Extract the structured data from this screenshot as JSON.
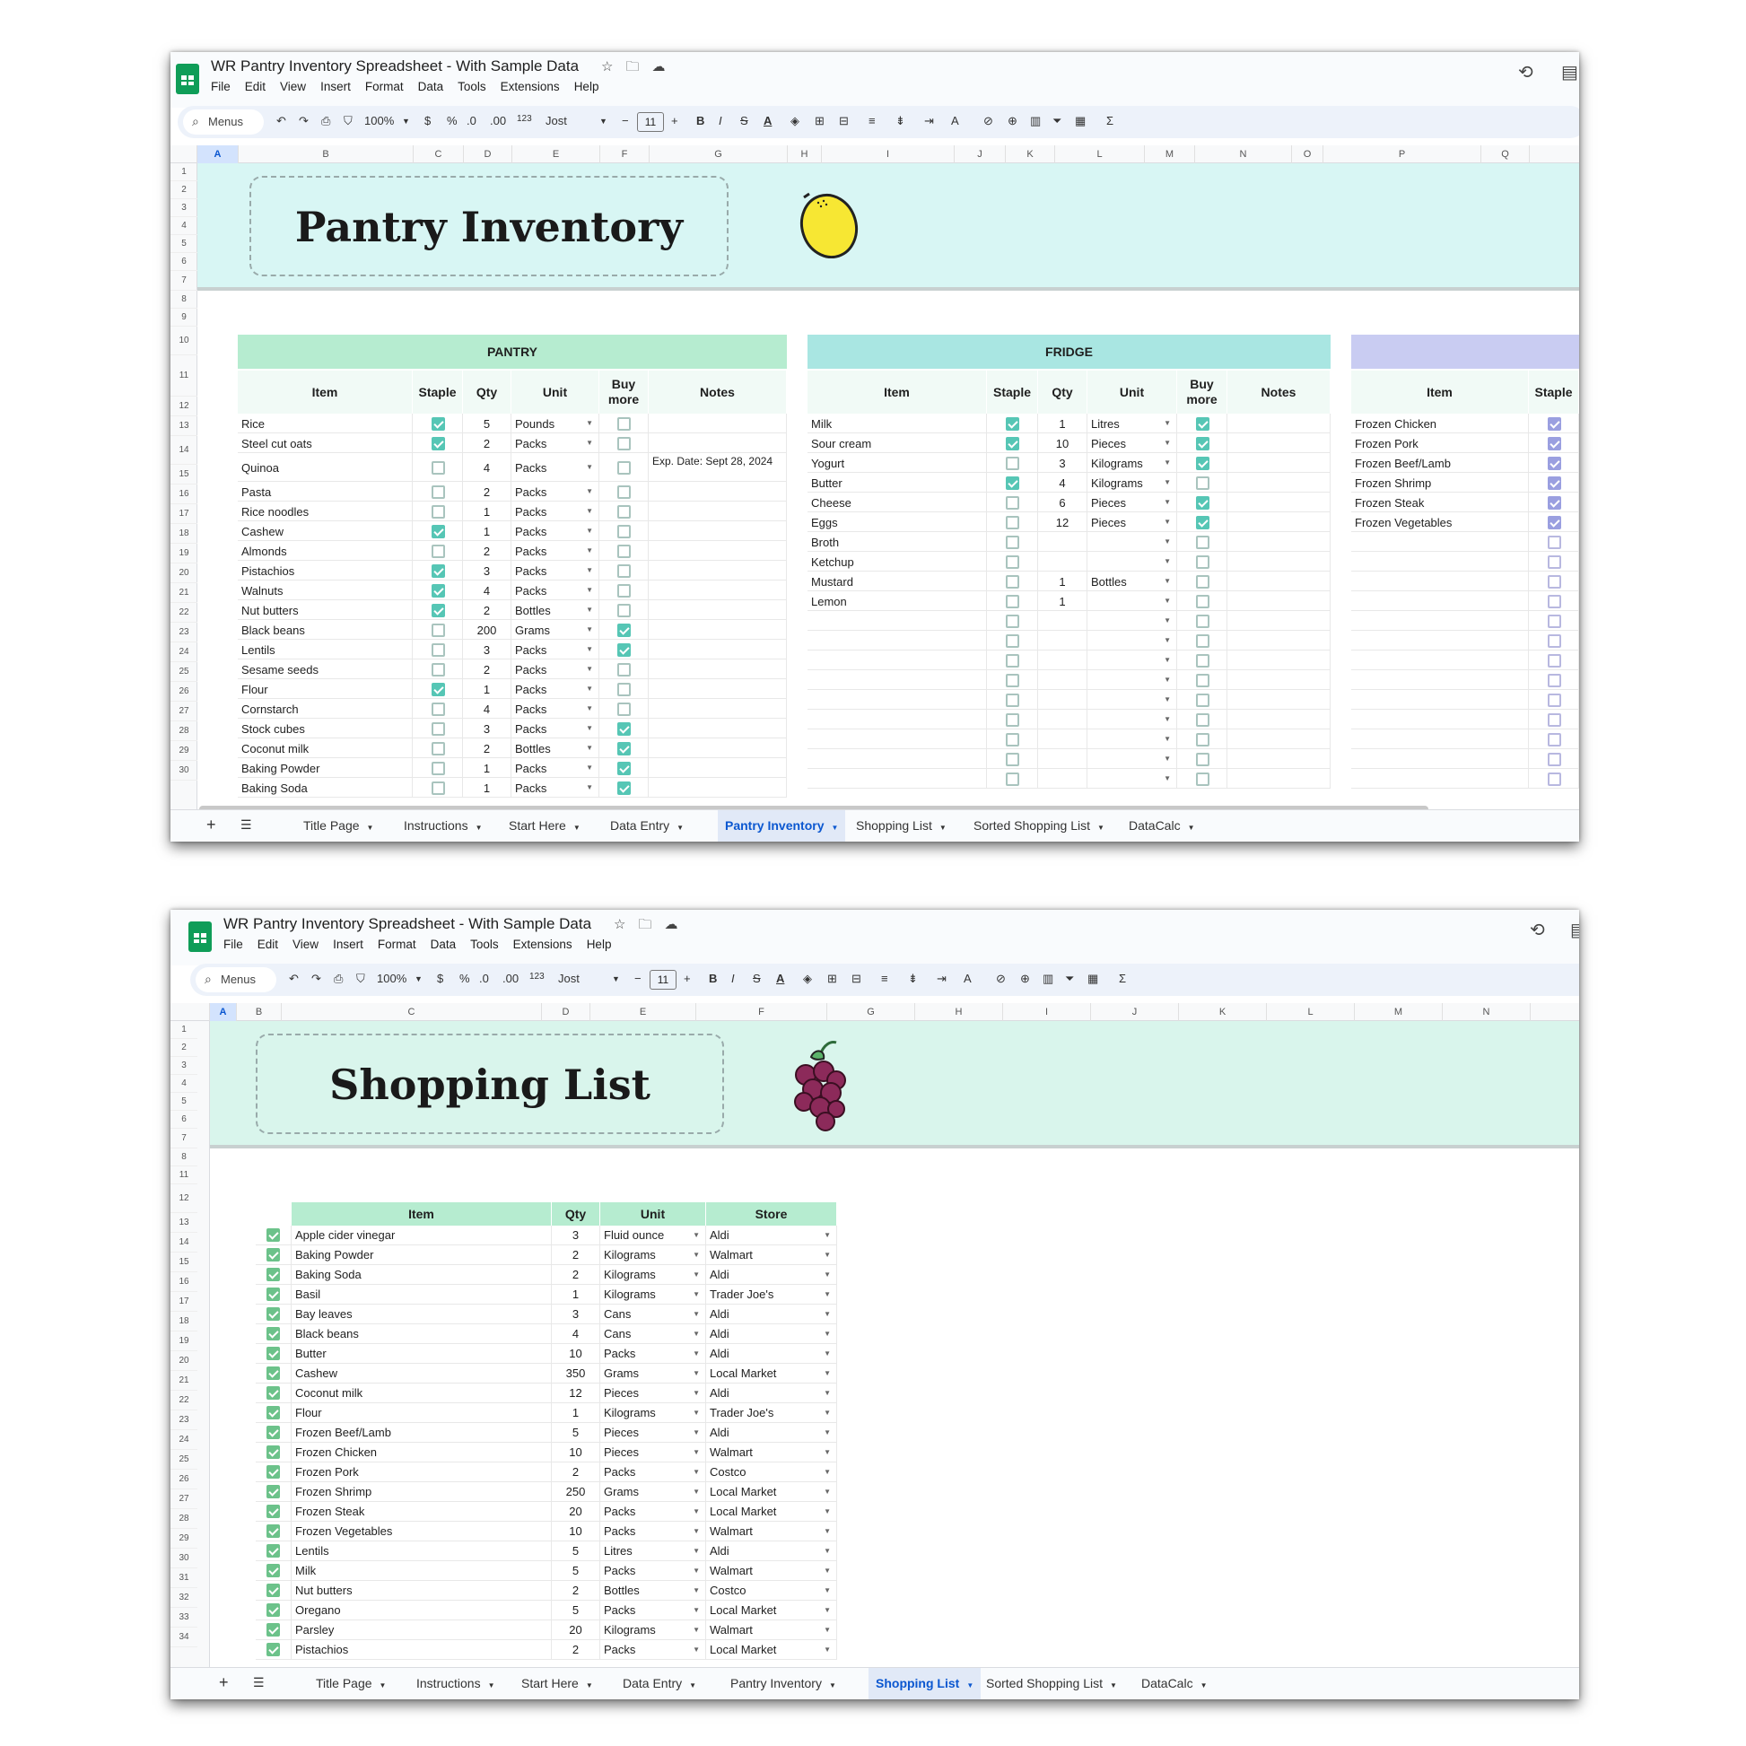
{
  "doc_title": "WR Pantry Inventory Spreadsheet - With Sample Data",
  "menus": [
    "File",
    "Edit",
    "View",
    "Insert",
    "Format",
    "Data",
    "Tools",
    "Extensions",
    "Help"
  ],
  "toolbar": {
    "search": "Menus",
    "zoom": "100%",
    "currency": "$",
    "percent": "%",
    "dec_minus": ".0",
    "dec_plus": ".00",
    "number_fmt": "123",
    "font": "Jost",
    "font_size": "11"
  },
  "tabs": [
    "Title Page",
    "Instructions",
    "Start Here",
    "Data Entry",
    "Pantry Inventory",
    "Shopping List",
    "Sorted Shopping List",
    "DataCalc"
  ],
  "sheet1": {
    "active_tab": "Pantry Inventory",
    "columns": [
      "A",
      "B",
      "C",
      "D",
      "E",
      "F",
      "G",
      "H",
      "I",
      "J",
      "K",
      "L",
      "M",
      "N",
      "O",
      "P",
      "Q"
    ],
    "rows": [
      "1",
      "2",
      "3",
      "4",
      "5",
      "6",
      "7",
      "8",
      "9",
      "10",
      "11",
      "12",
      "13",
      "14",
      "15",
      "16",
      "17",
      "18",
      "19",
      "20",
      "21",
      "22",
      "23",
      "24",
      "25",
      "26",
      "27",
      "28",
      "29",
      "30"
    ],
    "banner_title": "Pantry Inventory",
    "pantry": {
      "title": "PANTRY",
      "headers": [
        "Item",
        "Staple",
        "Qty",
        "Unit",
        "Buy\nmore",
        "Notes"
      ],
      "items": [
        [
          "Rice",
          true,
          "5",
          "Pounds",
          false,
          ""
        ],
        [
          "Steel cut oats",
          true,
          "2",
          "Packs",
          false,
          ""
        ],
        [
          "Quinoa",
          false,
          "4",
          "Packs",
          false,
          "Exp. Date: Sept 28, 2024"
        ],
        [
          "Pasta",
          false,
          "2",
          "Packs",
          false,
          ""
        ],
        [
          "Rice noodles",
          false,
          "1",
          "Packs",
          false,
          ""
        ],
        [
          "Cashew",
          true,
          "1",
          "Packs",
          false,
          ""
        ],
        [
          "Almonds",
          false,
          "2",
          "Packs",
          false,
          ""
        ],
        [
          "Pistachios",
          true,
          "3",
          "Packs",
          false,
          ""
        ],
        [
          "Walnuts",
          true,
          "4",
          "Packs",
          false,
          ""
        ],
        [
          "Nut butters",
          true,
          "2",
          "Bottles",
          false,
          ""
        ],
        [
          "Black beans",
          false,
          "200",
          "Grams",
          true,
          ""
        ],
        [
          "Lentils",
          false,
          "3",
          "Packs",
          true,
          ""
        ],
        [
          "Sesame seeds",
          false,
          "2",
          "Packs",
          false,
          ""
        ],
        [
          "Flour",
          true,
          "1",
          "Packs",
          false,
          ""
        ],
        [
          "Cornstarch",
          false,
          "4",
          "Packs",
          false,
          ""
        ],
        [
          "Stock cubes",
          false,
          "3",
          "Packs",
          true,
          ""
        ],
        [
          "Coconut milk",
          false,
          "2",
          "Bottles",
          true,
          ""
        ],
        [
          "Baking Powder",
          false,
          "1",
          "Packs",
          true,
          ""
        ],
        [
          "Baking Soda",
          false,
          "1",
          "Packs",
          true,
          ""
        ]
      ]
    },
    "fridge": {
      "title": "FRIDGE",
      "headers": [
        "Item",
        "Staple",
        "Qty",
        "Unit",
        "Buy\nmore",
        "Notes"
      ],
      "items": [
        [
          "Milk",
          true,
          "1",
          "Litres",
          true,
          ""
        ],
        [
          "Sour cream",
          true,
          "10",
          "Pieces",
          true,
          ""
        ],
        [
          "Yogurt",
          false,
          "3",
          "Kilograms",
          true,
          ""
        ],
        [
          "Butter",
          true,
          "4",
          "Kilograms",
          false,
          ""
        ],
        [
          "Cheese",
          false,
          "6",
          "Pieces",
          true,
          ""
        ],
        [
          "Eggs",
          false,
          "12",
          "Pieces",
          true,
          ""
        ],
        [
          "Broth",
          false,
          "",
          "",
          false,
          ""
        ],
        [
          "Ketchup",
          false,
          "",
          "",
          false,
          ""
        ],
        [
          "Mustard",
          false,
          "1",
          "Bottles",
          false,
          ""
        ],
        [
          "Lemon",
          false,
          "1",
          "",
          false,
          ""
        ],
        [
          "",
          false,
          "",
          "",
          false,
          ""
        ],
        [
          "",
          false,
          "",
          "",
          false,
          ""
        ],
        [
          "",
          false,
          "",
          "",
          false,
          ""
        ],
        [
          "",
          false,
          "",
          "",
          false,
          ""
        ],
        [
          "",
          false,
          "",
          "",
          false,
          ""
        ],
        [
          "",
          false,
          "",
          "",
          false,
          ""
        ],
        [
          "",
          false,
          "",
          "",
          false,
          ""
        ],
        [
          "",
          false,
          "",
          "",
          false,
          ""
        ],
        [
          "",
          false,
          "",
          "",
          false,
          ""
        ]
      ]
    },
    "freezer": {
      "headers": [
        "Item",
        "Staple"
      ],
      "items": [
        [
          "Frozen Chicken",
          true
        ],
        [
          "Frozen Pork",
          true
        ],
        [
          "Frozen Beef/Lamb",
          true
        ],
        [
          "Frozen Shrimp",
          true
        ],
        [
          "Frozen Steak",
          true
        ],
        [
          "Frozen Vegetables",
          true
        ],
        [
          "",
          false
        ],
        [
          "",
          false
        ],
        [
          "",
          false
        ],
        [
          "",
          false
        ],
        [
          "",
          false
        ],
        [
          "",
          false
        ],
        [
          "",
          false
        ],
        [
          "",
          false
        ],
        [
          "",
          false
        ],
        [
          "",
          false
        ],
        [
          "",
          false
        ],
        [
          "",
          false
        ],
        [
          "",
          false
        ]
      ]
    }
  },
  "sheet2": {
    "active_tab": "Shopping List",
    "columns": [
      "A",
      "B",
      "C",
      "D",
      "E",
      "F",
      "G",
      "H",
      "I",
      "J",
      "K",
      "L",
      "M",
      "N"
    ],
    "rows": [
      "1",
      "2",
      "3",
      "4",
      "5",
      "6",
      "7",
      "8",
      "11",
      "12",
      "13",
      "14",
      "15",
      "16",
      "17",
      "18",
      "19",
      "20",
      "21",
      "22",
      "23",
      "24",
      "25",
      "26",
      "27",
      "28",
      "29",
      "30",
      "31",
      "32",
      "33",
      "34"
    ],
    "banner_title": "Shopping List",
    "headers": [
      "Item",
      "Qty",
      "Unit",
      "Store"
    ],
    "items": [
      [
        "Apple cider vinegar",
        "3",
        "Fluid ounce",
        "Aldi"
      ],
      [
        "Baking Powder",
        "2",
        "Kilograms",
        "Walmart"
      ],
      [
        "Baking Soda",
        "2",
        "Kilograms",
        "Aldi"
      ],
      [
        "Basil",
        "1",
        "Kilograms",
        "Trader Joe's"
      ],
      [
        "Bay leaves",
        "3",
        "Cans",
        "Aldi"
      ],
      [
        "Black beans",
        "4",
        "Cans",
        "Aldi"
      ],
      [
        "Butter",
        "10",
        "Packs",
        "Aldi"
      ],
      [
        "Cashew",
        "350",
        "Grams",
        "Local Market"
      ],
      [
        "Coconut milk",
        "12",
        "Pieces",
        "Aldi"
      ],
      [
        "Flour",
        "1",
        "Kilograms",
        "Trader Joe's"
      ],
      [
        "Frozen Beef/Lamb",
        "5",
        "Pieces",
        "Aldi"
      ],
      [
        "Frozen Chicken",
        "10",
        "Pieces",
        "Walmart"
      ],
      [
        "Frozen Pork",
        "2",
        "Packs",
        "Costco"
      ],
      [
        "Frozen Shrimp",
        "250",
        "Grams",
        "Local Market"
      ],
      [
        "Frozen Steak",
        "20",
        "Packs",
        "Local Market"
      ],
      [
        "Frozen Vegetables",
        "10",
        "Packs",
        "Walmart"
      ],
      [
        "Lentils",
        "5",
        "Litres",
        "Aldi"
      ],
      [
        "Milk",
        "5",
        "Packs",
        "Walmart"
      ],
      [
        "Nut butters",
        "2",
        "Bottles",
        "Costco"
      ],
      [
        "Oregano",
        "5",
        "Packs",
        "Local Market"
      ],
      [
        "Parsley",
        "20",
        "Kilograms",
        "Walmart"
      ],
      [
        "Pistachios",
        "2",
        "Packs",
        "Local Market"
      ]
    ]
  },
  "colors": {
    "pantry_header": "#b6ecd0",
    "fridge_header": "#a9e6e2",
    "freezer_header": "#c9ccf2",
    "banner1": "#d8f6f4",
    "banner2": "#d9f5ec",
    "shopping_header": "#b6ecd0"
  }
}
